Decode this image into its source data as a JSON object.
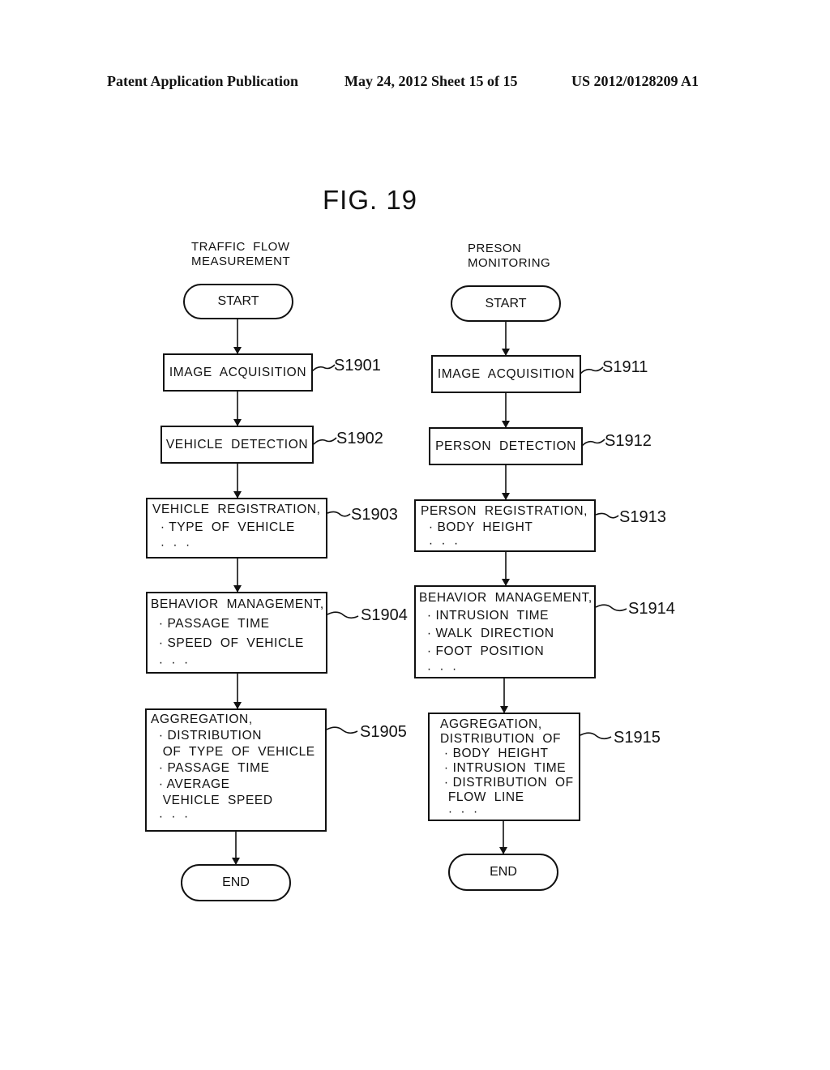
{
  "header": {
    "publication": "Patent Application Publication",
    "date_sheet": "May 24, 2012  Sheet 15 of 15",
    "number": "US 2012/0128209 A1"
  },
  "figure": {
    "title": "FIG. 19"
  },
  "left_flow": {
    "title": "TRAFFIC  FLOW\nMEASUREMENT",
    "start": "START",
    "end": "END",
    "steps": [
      {
        "id": "S1901",
        "text": "IMAGE  ACQUISITION"
      },
      {
        "id": "S1902",
        "text": "VEHICLE  DETECTION"
      },
      {
        "id": "S1903",
        "text": "VEHICLE  REGISTRATION,\n  · TYPE  OF  VEHICLE\n  ·  ·  ·"
      },
      {
        "id": "S1904",
        "text": "BEHAVIOR  MANAGEMENT,\n  · PASSAGE  TIME\n  · SPEED  OF  VEHICLE\n  ·  ·  ·"
      },
      {
        "id": "S1905",
        "text": "AGGREGATION,\n  · DISTRIBUTION\n   OF  TYPE  OF  VEHICLE\n  · PASSAGE  TIME\n  · AVERAGE\n   VEHICLE  SPEED\n  ·  ·  ·"
      }
    ]
  },
  "right_flow": {
    "title": "PRESON\nMONITORING",
    "start": "START",
    "end": "END",
    "steps": [
      {
        "id": "S1911",
        "text": "IMAGE  ACQUISITION"
      },
      {
        "id": "S1912",
        "text": "PERSON  DETECTION"
      },
      {
        "id": "S1913",
        "text": "PERSON  REGISTRATION,\n  · BODY  HEIGHT\n  ·  ·  ·"
      },
      {
        "id": "S1914",
        "text": "BEHAVIOR  MANAGEMENT,\n  · INTRUSION  TIME\n  · WALK  DIRECTION\n  · FOOT  POSITION\n  ·  ·  ·"
      },
      {
        "id": "S1915",
        "text": "AGGREGATION,\nDISTRIBUTION  OF\n · BODY  HEIGHT\n · INTRUSION  TIME\n · DISTRIBUTION  OF\n  FLOW  LINE\n  ·  ·  ·"
      }
    ]
  }
}
